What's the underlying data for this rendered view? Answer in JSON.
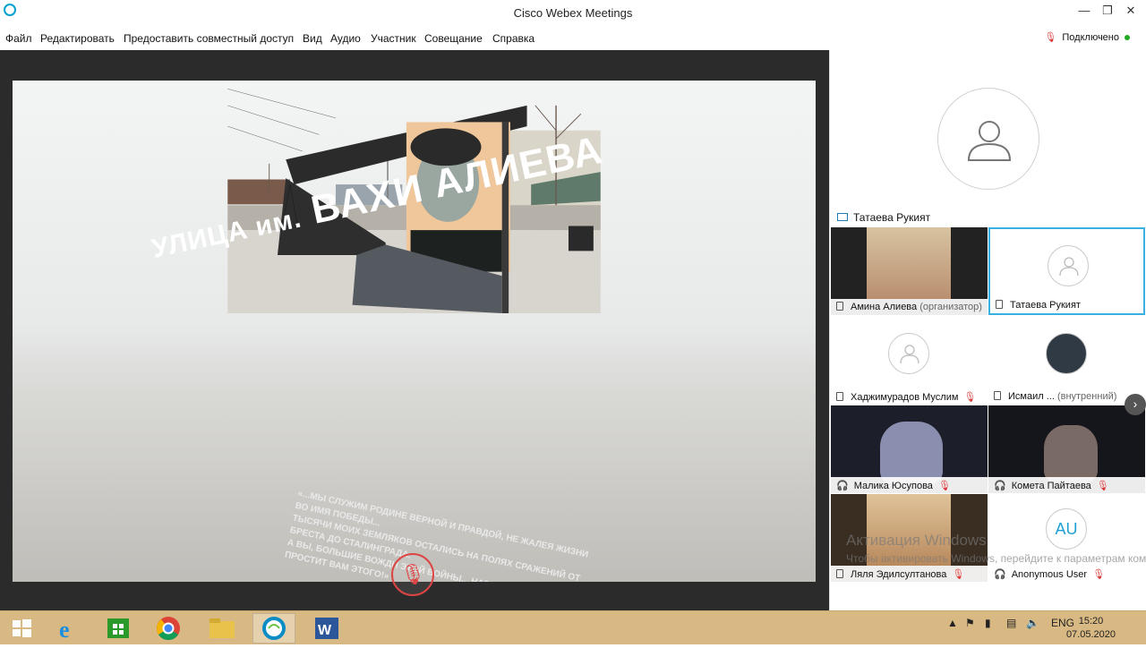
{
  "window": {
    "title": "Cisco Webex Meetings",
    "controls": {
      "minimize": "—",
      "restore": "❐",
      "close": "✕"
    }
  },
  "menu": [
    "Файл",
    "Редактировать",
    "Предоставить совместный доступ",
    "Вид",
    "Аудио",
    "Участник",
    "Совещание",
    "Справка"
  ],
  "status": {
    "text": "Подключено"
  },
  "shared_content": {
    "sign_prefix": "УЛИЦА им.",
    "sign_name": "ВАХИ АЛИЕВА",
    "plaque_line1": "«...МЫ СЛУЖИМ РОДИНЕ ВЕРНОЙ И ПРАВДОЙ, НЕ ЖАЛЕЯ ЖИЗНИ ВО ИМЯ ПОБЕДЫ...",
    "plaque_line2": "ТЫСЯЧИ МОИХ ЗЕМЛЯКОВ ОСТАЛИСЬ НА ПОЛЯХ СРАЖЕНИЙ ОТ БРЕСТА ДО СТАЛИНГРАДА.",
    "plaque_line3": "А ВЫ, БОЛЬШИЕ ВОЖДИ ЭТОЙ ВОЙНЫ... НАРОД НИКОГДА НЕ ПРОСТИТ ВАМ ЭТОГО!»"
  },
  "active_speaker": "Татаева Рукият",
  "participants": [
    {
      "name": "Амина Алиева",
      "sub": "(организатор)",
      "muted": false,
      "video": true
    },
    {
      "name": "Татаева Рукият",
      "sub": "",
      "muted": false,
      "video": false
    },
    {
      "name": "Хаджимурадов Муслим",
      "sub": "",
      "muted": true,
      "video": false
    },
    {
      "name": "Исмаил ...",
      "sub": "(внутренний)",
      "muted": true,
      "video": true
    },
    {
      "name": "Малика Юсупова",
      "sub": "",
      "muted": true,
      "video": true
    },
    {
      "name": "Комета Пайтаева",
      "sub": "",
      "muted": true,
      "video": true
    },
    {
      "name": "Ляля Эдилсултанова",
      "sub": "",
      "muted": true,
      "video": true
    },
    {
      "name": "Anonymous User",
      "sub": "",
      "muted": true,
      "video": false,
      "initials": "AU"
    }
  ],
  "watermark": {
    "line1": "Активация Windows",
    "line2": "Чтобы активировать Windows, перейдите к параметрам компьютера."
  },
  "taskbar": {
    "language": "ENG",
    "time": "15:20",
    "date": "07.05.2020"
  },
  "colors": {
    "accent": "#39b0e0",
    "muted": "#d33333",
    "taskbar": "#d9b983",
    "connected": "#22aa22"
  }
}
